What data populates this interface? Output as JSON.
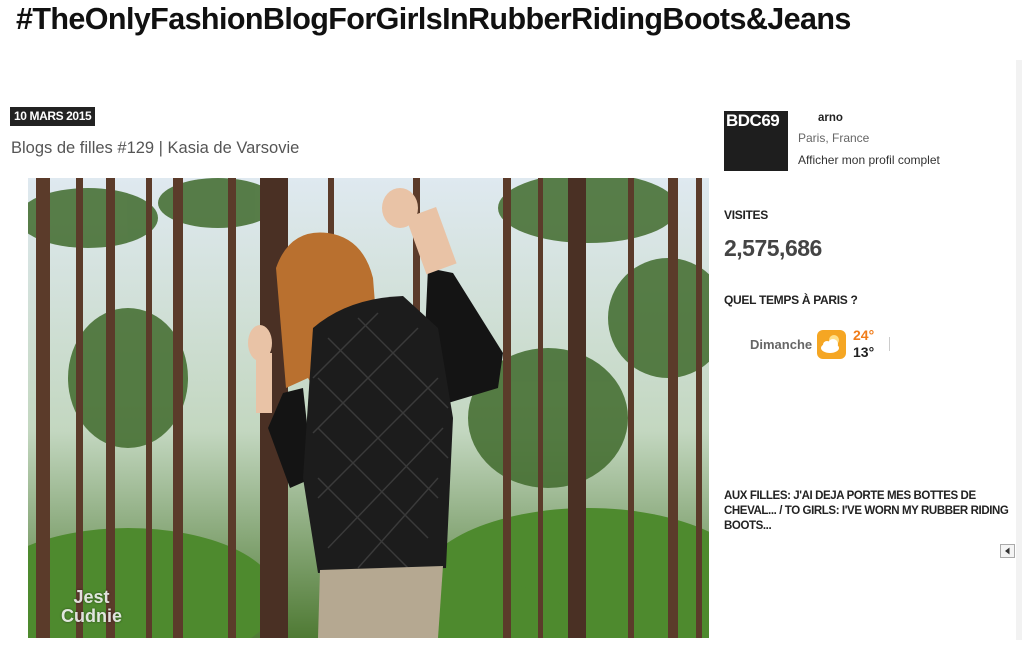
{
  "blog": {
    "title": "#TheOnlyFashionBlogForGirlsInRubberRidingBoots&Jeans"
  },
  "post": {
    "date": "10 MARS 2015",
    "title": "Blogs de filles #129 | Kasia de Varsovie",
    "image_watermark_line1": "Jest",
    "image_watermark_line2": "Cudnie"
  },
  "profile": {
    "avatar_text": "BDC69",
    "name": "arno",
    "location": "Paris, France",
    "link_label": "Afficher mon profil complet"
  },
  "visits": {
    "heading": "VISITES",
    "count": "2,575,686"
  },
  "weather": {
    "heading": "QUEL TEMPS À PARIS ?",
    "day": "Dimanche",
    "high": "24°",
    "low": "13°",
    "icon": "partly-cloudy-icon"
  },
  "featured": {
    "heading": "AUX FILLES: J'AI DEJA PORTE MES BOTTES DE CHEVAL... / TO GIRLS: I'VE WORN MY RUBBER RIDING BOOTS..."
  },
  "colors": {
    "date_badge_bg": "#222222",
    "temp_high": "#f07c1a",
    "weather_icon_bg": "#f5a623"
  }
}
